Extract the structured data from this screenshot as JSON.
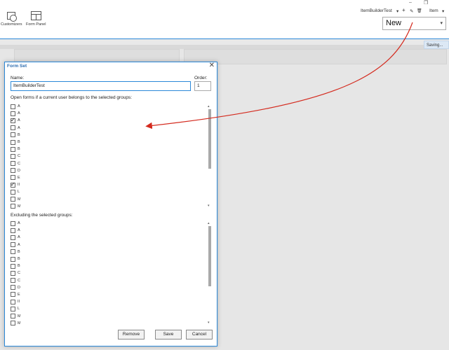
{
  "toolbar": {
    "customizers_label": "Customizers",
    "form_panel_label": "Form Panel",
    "item_name": "ItemBuilderTest",
    "item_name_caret": "▾",
    "plus_icon": "+",
    "edit_icon": "✎",
    "delete_icon": "🗑",
    "item_menu": "Item",
    "item_menu_caret": "▾",
    "new_select_value": "New",
    "new_select_caret": "▾",
    "minimize": "–",
    "restore": "❐"
  },
  "status": {
    "saving_text": "Saving...",
    "saving_close": "X"
  },
  "dialog": {
    "title": "Form Set",
    "close": "✕",
    "name_label": "Name:",
    "name_value": "ItemBuilderTest",
    "order_label": "Order:",
    "order_value": "1",
    "open_groups_label": "Open forms if a current user belongs to the selected groups:",
    "open_groups": [
      {
        "text": "A",
        "checked": false
      },
      {
        "text": "A",
        "checked": false
      },
      {
        "text": "A",
        "checked": true
      },
      {
        "text": "A",
        "checked": false
      },
      {
        "text": "B",
        "checked": false
      },
      {
        "text": "B",
        "checked": false
      },
      {
        "text": "B",
        "checked": false
      },
      {
        "text": "C",
        "checked": false
      },
      {
        "text": "C",
        "checked": false
      },
      {
        "text": "D",
        "checked": false
      },
      {
        "text": "E",
        "checked": false
      },
      {
        "text": "II",
        "checked": true
      },
      {
        "text": "L",
        "checked": false
      },
      {
        "text": "M",
        "checked": false
      },
      {
        "text": "M",
        "checked": false
      }
    ],
    "excluding_label": "Excluding the selected groups:",
    "excluding_groups": [
      {
        "text": "A",
        "checked": false
      },
      {
        "text": "A",
        "checked": false
      },
      {
        "text": "A",
        "checked": false
      },
      {
        "text": "A",
        "checked": false
      },
      {
        "text": "B",
        "checked": false
      },
      {
        "text": "B",
        "checked": false
      },
      {
        "text": "B",
        "checked": false
      },
      {
        "text": "C",
        "checked": false
      },
      {
        "text": "C",
        "checked": false
      },
      {
        "text": "D",
        "checked": false
      },
      {
        "text": "E",
        "checked": false
      },
      {
        "text": "II",
        "checked": false
      },
      {
        "text": "L",
        "checked": false
      },
      {
        "text": "M",
        "checked": false
      },
      {
        "text": "M",
        "checked": false
      }
    ],
    "remove_label": "Remove",
    "save_label": "Save",
    "cancel_label": "Cancel"
  },
  "annotation": {
    "arrow_color": "#d42a1e"
  }
}
